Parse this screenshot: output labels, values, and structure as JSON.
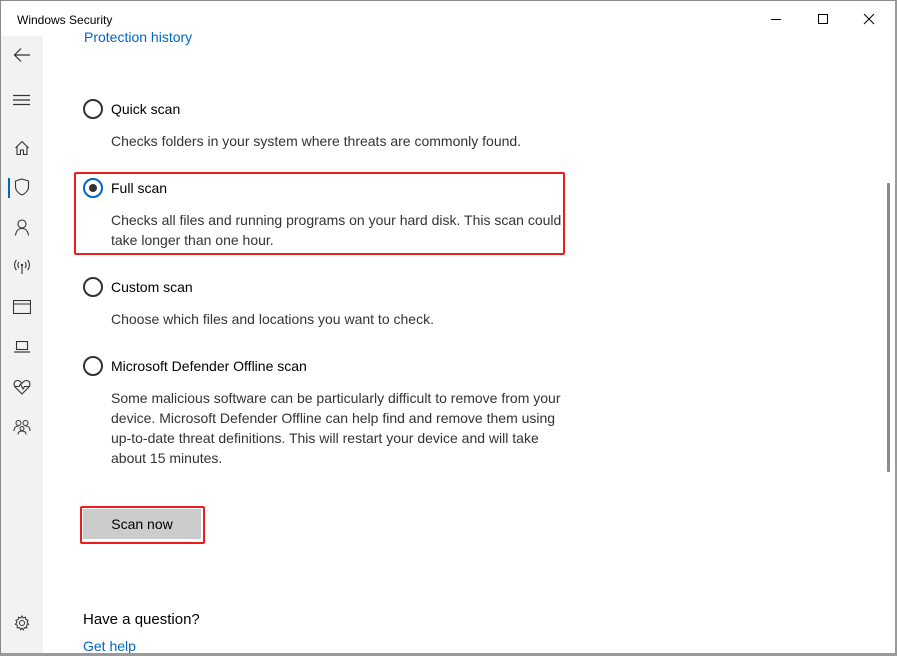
{
  "window": {
    "title": "Windows Security",
    "controls": {
      "minimize": "minimize",
      "maximize": "maximize",
      "close": "close"
    }
  },
  "sidebar": {
    "items": [
      {
        "name": "back",
        "icon": "back-arrow-icon"
      },
      {
        "name": "menu",
        "icon": "hamburger-menu-icon"
      },
      {
        "name": "home",
        "icon": "home-icon"
      },
      {
        "name": "virus-threat-protection",
        "icon": "shield-icon",
        "active": true
      },
      {
        "name": "account-protection",
        "icon": "person-icon"
      },
      {
        "name": "firewall-network",
        "icon": "wireless-antenna-icon"
      },
      {
        "name": "app-browser-control",
        "icon": "app-window-icon"
      },
      {
        "name": "device-security",
        "icon": "laptop-icon"
      },
      {
        "name": "device-performance-health",
        "icon": "heart-pulse-icon"
      },
      {
        "name": "family-options",
        "icon": "family-icon"
      },
      {
        "name": "settings",
        "icon": "gear-icon"
      }
    ]
  },
  "main": {
    "protection_history_link": "Protection history",
    "scan_options": [
      {
        "label": "Quick scan",
        "description": "Checks folders in your system where threats are commonly found.",
        "selected": false
      },
      {
        "label": "Full scan",
        "description": "Checks all files and running programs on your hard disk. This scan could take longer than one hour.",
        "selected": true
      },
      {
        "label": "Custom scan",
        "description": "Choose which files and locations you want to check.",
        "selected": false
      },
      {
        "label": "Microsoft Defender Offline scan",
        "description": "Some malicious software can be particularly difficult to remove from your device. Microsoft Defender Offline can help find and remove them using up-to-date threat definitions. This will restart your device and will take about 15 minutes.",
        "selected": false
      }
    ],
    "scan_now_button": "Scan now",
    "question_heading": "Have a question?",
    "get_help_link": "Get help"
  },
  "colors": {
    "accent": "#0067c0",
    "highlight_box": "#ee1c1c",
    "sidebar_bg": "#f2f2f2",
    "button_bg": "#cccccc"
  }
}
